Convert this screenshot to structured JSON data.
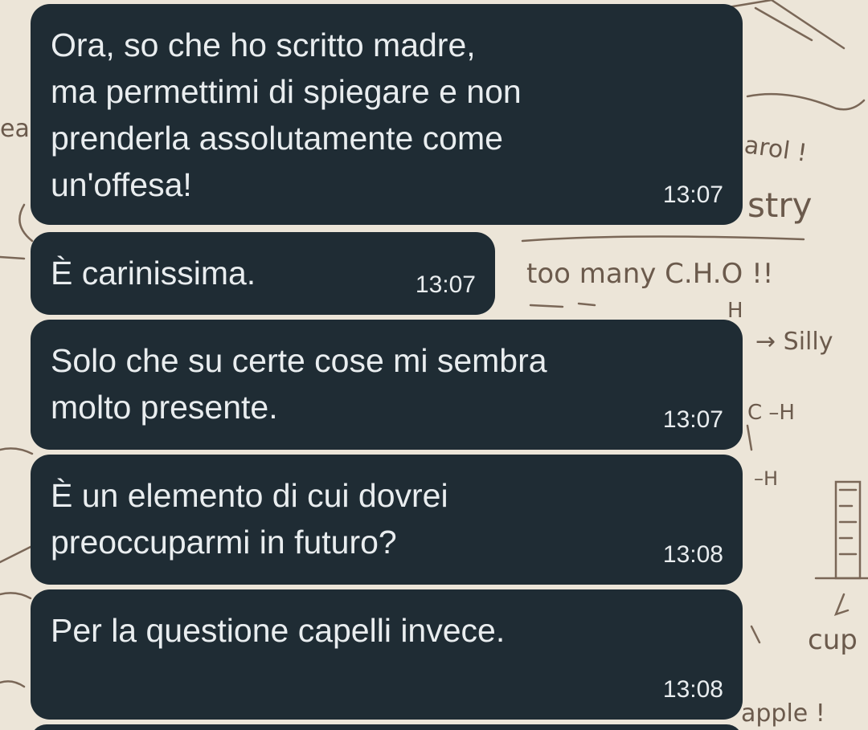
{
  "chat": {
    "messages": [
      {
        "text": "Ora, so che ho scritto madre,\nma permettimi di spiegare e non\nprenderla assolutamente come\nun'offesa!",
        "time": "13:07"
      },
      {
        "text": "È carinissima.",
        "time": "13:07"
      },
      {
        "text": "Solo che su certe cose mi sembra\nmolto presente.",
        "time": "13:07"
      },
      {
        "text": "È un elemento di cui dovrei\npreoccuparmi in futuro?",
        "time": "13:08"
      },
      {
        "text": "Per la questione capelli invece.",
        "time": "13:08"
      }
    ]
  },
  "wallpaper": {
    "doodles": [
      "arol !",
      "stry",
      "too many C.H.O !!",
      "H",
      "→ Silly",
      "C –H",
      "–H",
      "cup",
      "apple !",
      "ea"
    ]
  },
  "colors": {
    "bubble": "#1f2c34",
    "text": "#e9edef",
    "wallpaper": "#ece5d8",
    "doodle": "#6b5a4c"
  }
}
